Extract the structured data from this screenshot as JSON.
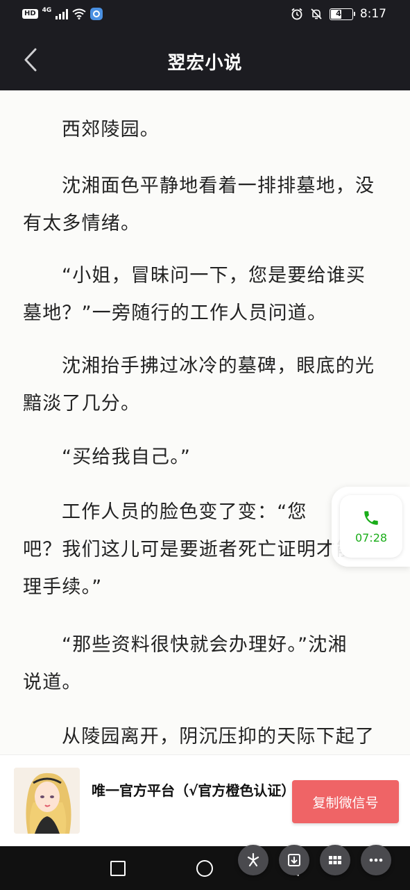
{
  "status_bar": {
    "hd_badge": "HD",
    "network": "4G",
    "battery": "48",
    "time": "8:17",
    "icons": [
      "signal-icon",
      "wifi-icon",
      "app-icon",
      "alarm-icon",
      "mute-icon",
      "battery-icon"
    ]
  },
  "header": {
    "title": "翌宏小说",
    "back_icon": "chevron-left-icon"
  },
  "content": {
    "paragraphs": [
      [
        "西郊陵园。"
      ],
      [
        "沈湘面色平静地看着一排排墓地，没",
        "有太多情绪。"
      ],
      [
        "“小姐，冒昧问一下，您是要给谁买",
        "墓地？”一旁随行的工作人员问道。"
      ],
      [
        "沈湘抬手拂过冰冷的墓碑，眼底的光",
        "黯淡了几分。"
      ],
      [
        "“买给我自己。”"
      ],
      [
        "工作人员的脸色变了变：“您",
        "吧？我们这儿可是要逝者死亡证明才能办",
        "理手续。”"
      ],
      [
        "“那些资料很快就会办理好。”沈湘",
        "说道。"
      ],
      [
        "从陵园离开，阴沉压抑的天际下起了"
      ]
    ]
  },
  "call_widget": {
    "icon": "phone-icon",
    "duration": "07:28"
  },
  "ad": {
    "text": "唯一官方平台（√官方橙色认证）",
    "button_label": "复制微信号"
  },
  "navbar": {
    "icons": [
      "square-recent-icon",
      "circle-home-icon",
      "triangle-back-icon"
    ],
    "floating": [
      "sparkle-icon",
      "download-icon",
      "grid-icon",
      "more-icon"
    ]
  },
  "colors": {
    "header_bg": "#1c1c21",
    "reader_bg": "#fbfbf9",
    "ad_button": "#ef6466",
    "call_green": "#1aad19"
  }
}
